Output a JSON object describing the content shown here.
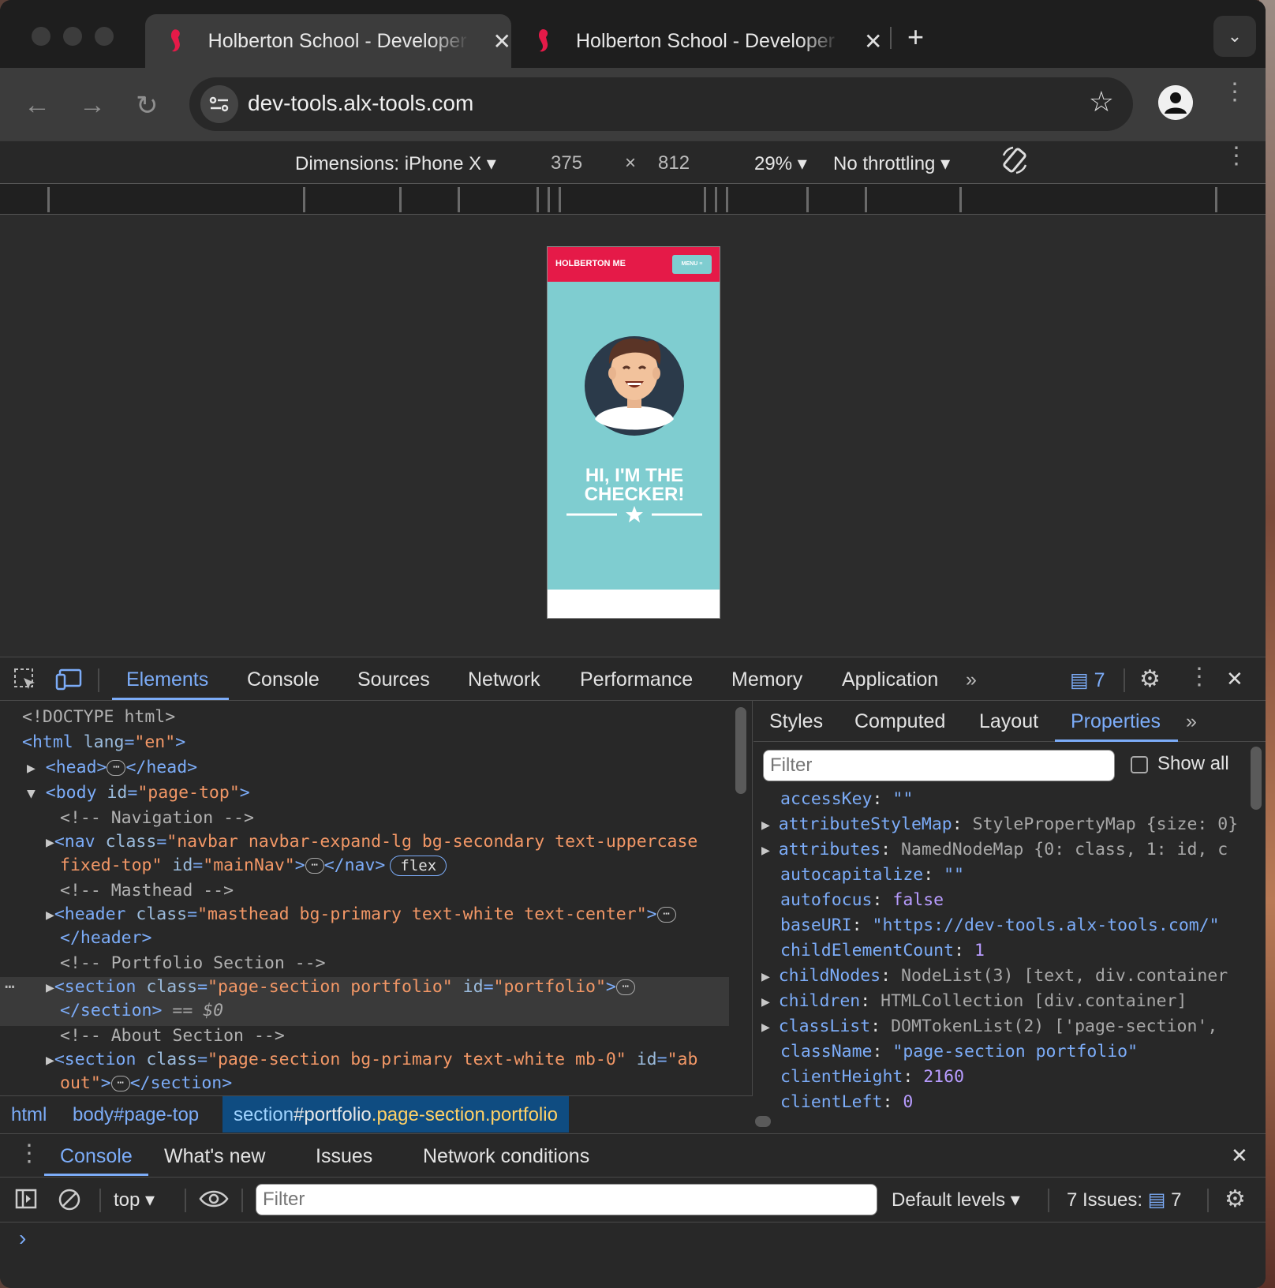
{
  "browser": {
    "tabs": [
      {
        "title": "Holberton School - Developer"
      },
      {
        "title": "Holberton School - Developer"
      }
    ],
    "url": "dev-tools.alx-tools.com"
  },
  "device_toolbar": {
    "dimensions": "Dimensions: iPhone X",
    "width": "375",
    "times": "×",
    "height": "812",
    "zoom": "29%",
    "throttling": "No throttling"
  },
  "phone_page": {
    "brand": "HOLBERTON ME",
    "menu": "MENU ≡",
    "title_line1": "HI, I'M THE",
    "title_line2": "CHECKER!"
  },
  "devtools": {
    "tabs": [
      "Elements",
      "Console",
      "Sources",
      "Network",
      "Performance",
      "Memory",
      "Application"
    ],
    "issues_count": "7",
    "dom": {
      "doctype": "<!DOCTYPE html>",
      "html_open": "<html",
      "html_attr": "lang",
      "html_val": "\"en\"",
      "head_open": "<head>",
      "head_close": "</head>",
      "body_open": "<body",
      "body_attr": "id",
      "body_val": "\"page-top\"",
      "c_nav": "<!-- Navigation -->",
      "nav_open": "<nav",
      "nav_class_val_1": "\"navbar navbar-expand-lg bg-secondary text-uppercase",
      "nav_class_val_2": "fixed-top\"",
      "nav_id_val": "\"mainNav\"",
      "nav_close": "</nav>",
      "flex": "flex",
      "c_masthead": "<!-- Masthead -->",
      "header_open": "<header",
      "header_class_val": "\"masthead bg-primary text-white text-center\"",
      "header_close": "</header>",
      "c_portfolio": "<!-- Portfolio Section -->",
      "section_open": "<section",
      "portfolio_class_val": "\"page-section portfolio\"",
      "portfolio_id_val": "\"portfolio\"",
      "section_close": "</section>",
      "dollar0": "== $0",
      "c_about": "<!-- About Section -->",
      "about_class_val": "\"page-section bg-primary text-white mb-0\"",
      "about_id_val_1": "\"ab",
      "about_id_val_2": "out\""
    },
    "breadcrumbs": [
      "html",
      "body#page-top"
    ],
    "breadcrumb_selected": {
      "tag": "section",
      "id": "#portfolio",
      "cls": ".page-section.portfolio"
    },
    "sidebar_tabs": [
      "Styles",
      "Computed",
      "Layout",
      "Properties"
    ],
    "filter_placeholder": "Filter",
    "show_all": "Show all",
    "properties": [
      {
        "key": "accessKey",
        "value": "\"\""
      },
      {
        "key": "attributeStyleMap",
        "value": "StylePropertyMap {size: 0}"
      },
      {
        "key": "attributes",
        "value": "NamedNodeMap {0: class, 1: id, c"
      },
      {
        "key": "autocapitalize",
        "value": "\"\""
      },
      {
        "key": "autofocus",
        "value": "false"
      },
      {
        "key": "baseURI",
        "value": "\"https://dev-tools.alx-tools.com/\""
      },
      {
        "key": "childElementCount",
        "value": "1"
      },
      {
        "key": "childNodes",
        "value": "NodeList(3) [text, div.container"
      },
      {
        "key": "children",
        "value": "HTMLCollection [div.container]"
      },
      {
        "key": "classList",
        "value": "DOMTokenList(2) ['page-section',"
      },
      {
        "key": "className",
        "value": "\"page-section portfolio\""
      },
      {
        "key": "clientHeight",
        "value": "2160"
      },
      {
        "key": "clientLeft",
        "value": "0"
      }
    ],
    "drawer_tabs": [
      "Console",
      "What's new",
      "Issues",
      "Network conditions"
    ],
    "console_context": "top",
    "console_filter_placeholder": "Filter",
    "default_levels": "Default levels",
    "issues_label": "7 Issues:",
    "issues_badge": "7",
    "prompt": "›"
  },
  "colors": {
    "accent": "#7cacf8",
    "phone_nav": "#e51a48",
    "phone_hero": "#7fcdd0"
  }
}
